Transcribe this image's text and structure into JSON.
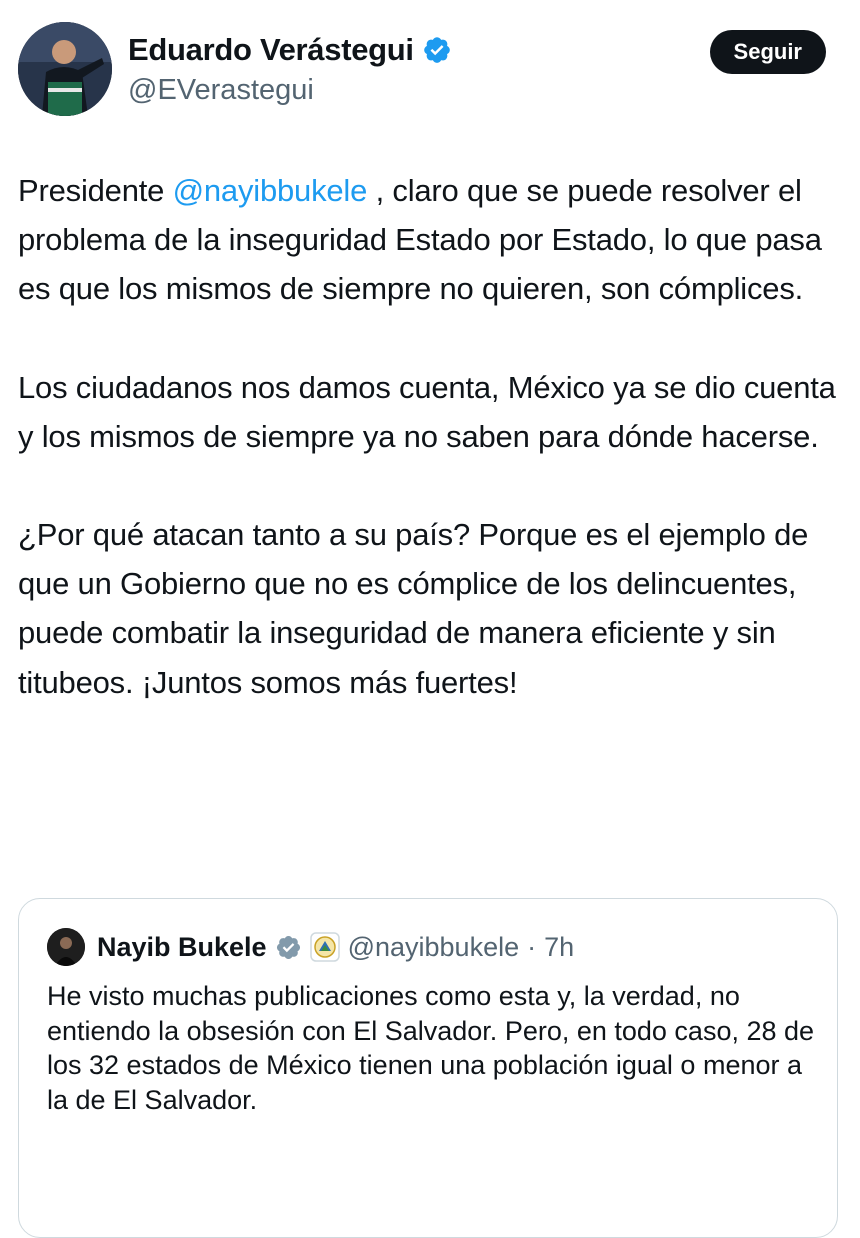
{
  "tweet": {
    "author": {
      "display_name": "Eduardo Verástegui",
      "handle": "@EVerastegui",
      "verified": true,
      "avatar_icon": "profile-photo-speaker-at-podium"
    },
    "follow_label": "Seguir",
    "paragraphs": [
      {
        "before": "Presidente ",
        "mention": "@nayibbukele",
        "after": " , claro que se puede resolver el problema de la inseguridad Estado por Estado, lo que pasa es que los mismos de siempre no quieren, son cómplices."
      },
      {
        "text": "Los ciudadanos nos damos cuenta, México ya se dio cuenta y los mismos de siempre ya no saben para dónde hacerse."
      },
      {
        "text": "¿Por qué atacan tanto a su país? Porque es el ejemplo de que un Gobierno que no es cómplice de los delincuentes, puede combatir la inseguridad de manera eficiente y sin titubeos. ¡Juntos somos más fuertes!"
      }
    ]
  },
  "quote": {
    "display_name": "Nayib Bukele",
    "verified": true,
    "affiliate_badge_icon": "el-salvador-coat-of-arms-icon",
    "handle": "@nayibbukele",
    "separator": "·",
    "time": "7h",
    "text": "He visto muchas publicaciones como esta y, la verdad, no entiendo la obsesión con El Salvador. Pero, en todo caso, 28 de los 32 estados de México tienen una población igual o menor a la de El Salvador."
  },
  "colors": {
    "text": "#0f1419",
    "secondary": "#536471",
    "link": "#1d9bf0",
    "verified": "#1d9bf0",
    "button_bg": "#0f1419",
    "border": "#cfd9de"
  }
}
